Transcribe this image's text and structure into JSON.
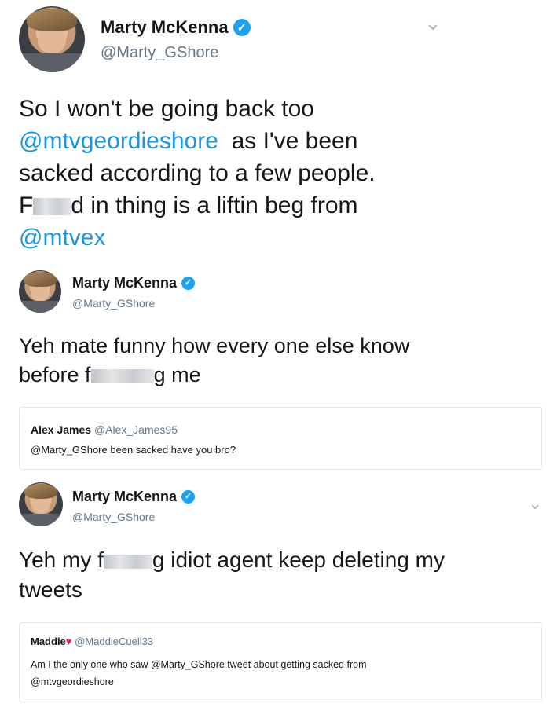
{
  "tweet1": {
    "name": "Marty McKenna",
    "handle": "@Marty_GShore",
    "line1": "So I won't be going back too",
    "mention1": "@mtvgeordieshore",
    "line2_rest": "as I've been",
    "line3": "sacked according to a few people.",
    "line4_start": "F",
    "line4_end": "d in thing is a liftin beg from",
    "mention2": "@mtvex"
  },
  "tweet2": {
    "name": "Marty McKenna",
    "handle": "@Marty_GShore",
    "line1": "Yeh mate funny how every one else know",
    "line2_start": "before f",
    "line2_end": "g me"
  },
  "quote1": {
    "name": "Alex James",
    "handle": "@Alex_James95",
    "text": "@Marty_GShore been sacked have you bro?"
  },
  "tweet3": {
    "name": "Marty McKenna",
    "handle": "@Marty_GShore",
    "line1_start": "Yeh my f",
    "line1_end": "g idiot agent keep deleting my",
    "line2": "tweets"
  },
  "quote2": {
    "name": "Maddie",
    "heart": "♥",
    "handle": "@MaddieCuell33",
    "line1": "Am I the only one who saw @Marty_GShore tweet about getting sacked from",
    "line2": "@mtvgeordieshore"
  },
  "icons": {
    "verified": "✓",
    "chevron": "⌄"
  }
}
